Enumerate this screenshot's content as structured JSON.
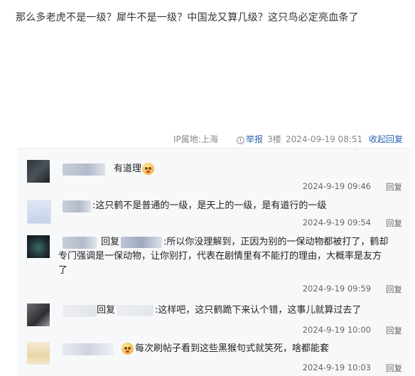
{
  "post": {
    "text": "那么多老虎不是一级？犀牛不是一级？中国龙又算几级？这只鸟必定亮血条了",
    "ip_label": "IP属地:上海",
    "report_label": "举报",
    "floor_label": "3楼",
    "timestamp": "2024-09-19 08:51",
    "collapse_label": "收起回复"
  },
  "replies": [
    {
      "text": "有道理",
      "has_emoji": true,
      "time": "2024-9-19 09:46",
      "reply_label": "回复"
    },
    {
      "text": ":这只鹤不是普通的一级，是天上的一级，是有道行的一级",
      "time": "2024-9-19 09:54",
      "reply_label": "回复"
    },
    {
      "prefix": "回复",
      "line1": ":所以你没理解到，正因为别的一保动物都被打了，鹤却",
      "line2": "专门强调是一保动物，让你别打，代表在剧情里有不能打的理由，大概率是友方",
      "line3": "了",
      "time": "2024-9-19 09:59",
      "reply_label": "回复"
    },
    {
      "prefix": "回复",
      "text": ":这样吧，这只鹤跪下来认个错，这事儿就算过去了",
      "time": "2024-9-19 10:00",
      "reply_label": "回复"
    },
    {
      "text": "每次刷帖子看到这些黑猴句式就笑死，啥都能套",
      "has_emoji": true,
      "time": "2024-9-19 10:03",
      "reply_label": "回复"
    }
  ],
  "colors": {
    "link": "#2d64b3",
    "meta": "#888888",
    "reply_bg": "#f7f8fa"
  }
}
